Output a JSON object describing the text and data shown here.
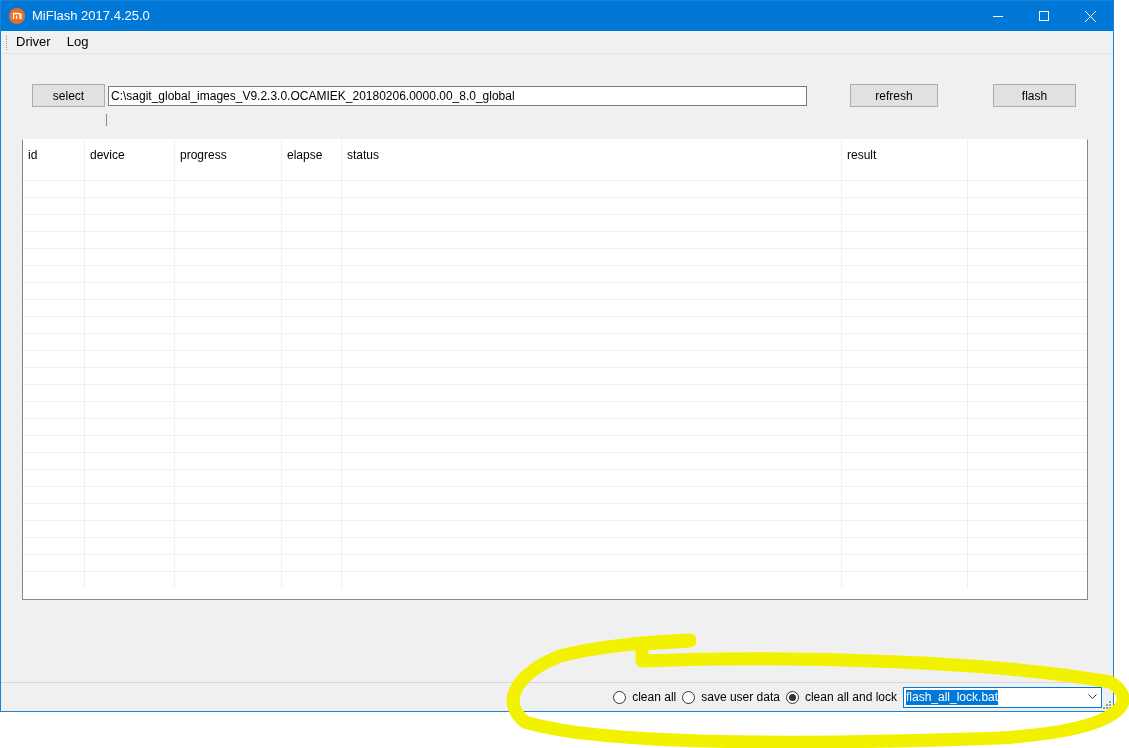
{
  "window": {
    "title": "MiFlash 2017.4.25.0"
  },
  "menu": [
    "Driver",
    "Log"
  ],
  "toolbar": {
    "select_button": "select",
    "path_field": {
      "value": "C:\\sagit_global_images_V9.2.3.0.OCAMIEK_20180206.0000.00_8.0_global"
    },
    "refresh_button": "refresh",
    "flash_button": "flash"
  },
  "table": {
    "columns": [
      "id",
      "device",
      "progress",
      "elapse",
      "status",
      "result"
    ]
  },
  "options": [
    {
      "label": "clean all",
      "selected": false
    },
    {
      "label": "save user data",
      "selected": false
    },
    {
      "label": "clean all and lock",
      "selected": true
    }
  ],
  "script_dropdown": {
    "value": "flash_all_lock.bat"
  }
}
